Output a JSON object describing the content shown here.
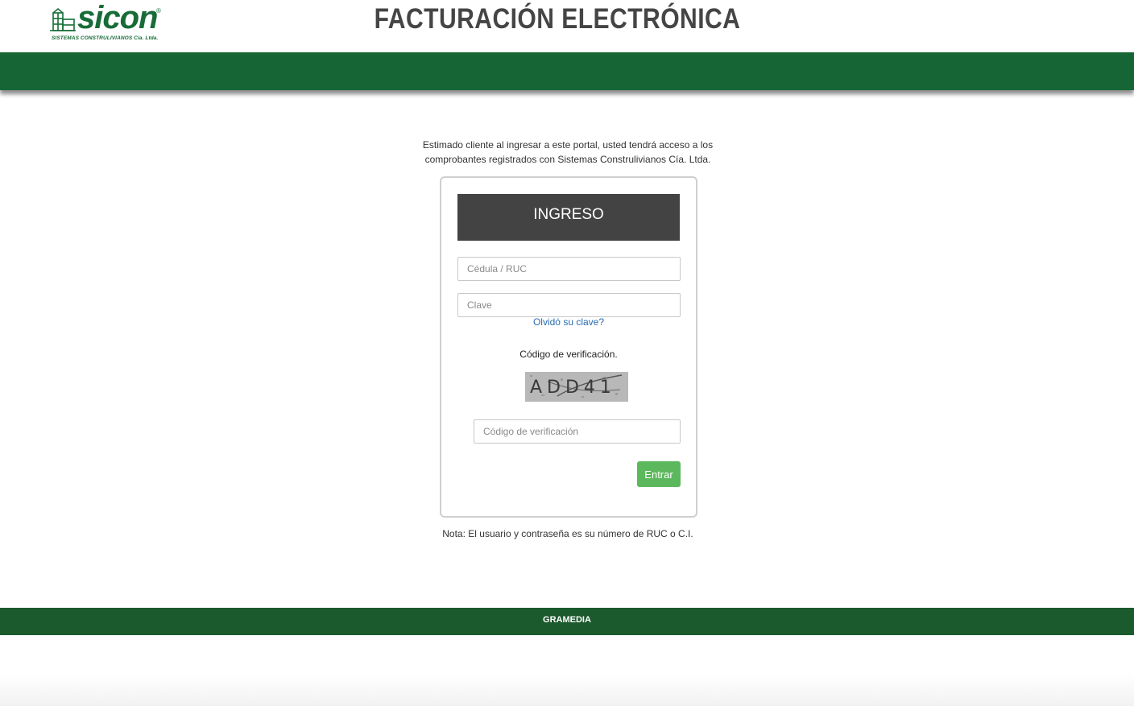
{
  "header": {
    "logo": {
      "word": "sicon",
      "registered": "®",
      "subtitle": "SISTEMAS CONSTRULIVIANOS Cía. Ltda.",
      "vertical_text": "SISTEMAS"
    },
    "title": "FACTURACIÓN ELECTRÓNICA"
  },
  "intro": "Estimado cliente al ingresar a este portal, usted tendrá acceso a los comprobantes registrados con Sistemas Construlivianos Cía. Ltda.",
  "login": {
    "heading": "INGRESO",
    "cedula_placeholder": "Cédula / RUC",
    "cedula_value": "",
    "clave_placeholder": "Clave",
    "clave_value": "",
    "forgot_link": "Olvidó su clave?",
    "verification_label": "Código de verificación.",
    "captcha_text": "ADD41",
    "verification_placeholder": "Código de verificación",
    "verification_value": "",
    "submit_label": "Entrar"
  },
  "note": "Nota: El usuario y contraseña es su número de RUC o C.I.",
  "footer": {
    "text": "GRAMEDIA"
  },
  "colors": {
    "brand_green": "#156634",
    "footer_green": "#1b5a2d",
    "login_header": "#444343",
    "button_green": "#5cb85c",
    "link_blue": "#2a6cb0",
    "title_gray": "#454545"
  }
}
